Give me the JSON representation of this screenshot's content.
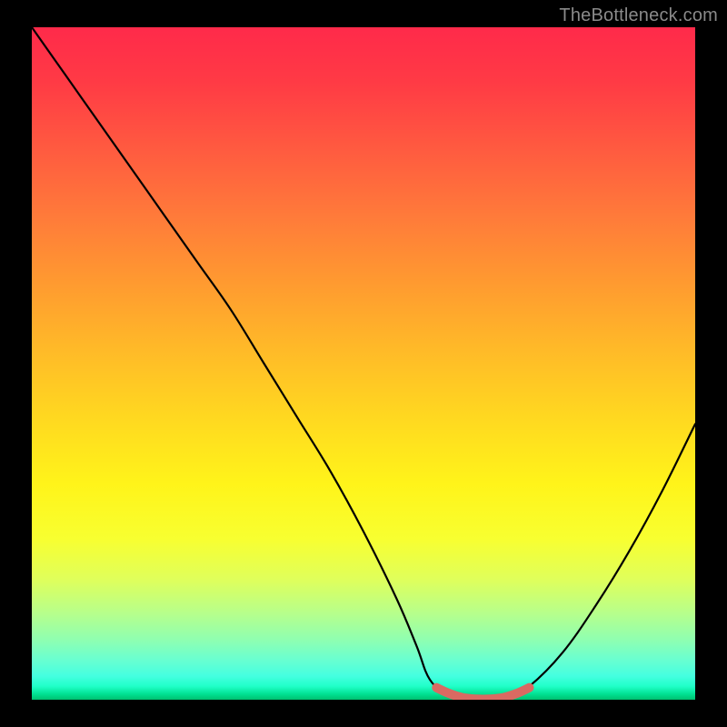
{
  "watermark": "TheBottleneck.com",
  "chart_data": {
    "type": "line",
    "title": "",
    "xlabel": "",
    "ylabel": "",
    "xlim": [
      0,
      100
    ],
    "ylim": [
      0,
      100
    ],
    "series": [
      {
        "name": "bottleneck-curve",
        "x": [
          0,
          5,
          10,
          15,
          20,
          25,
          30,
          35,
          40,
          45,
          50,
          55,
          58,
          60,
          63,
          66,
          69,
          72,
          75,
          80,
          85,
          90,
          95,
          100
        ],
        "values": [
          100,
          93,
          86,
          79,
          72,
          65,
          58,
          50,
          42,
          34,
          25,
          15,
          8,
          3,
          0.5,
          0,
          0,
          0.5,
          2,
          7,
          14,
          22,
          31,
          41
        ]
      },
      {
        "name": "optimal-range-marker",
        "x": [
          61,
          63,
          65,
          67,
          69,
          71,
          73,
          75
        ],
        "values": [
          1.8,
          0.9,
          0.3,
          0.1,
          0.1,
          0.3,
          0.9,
          1.8
        ]
      }
    ],
    "background_gradient": {
      "top_color": "#ff2a4a",
      "mid_color": "#fff41a",
      "bottom_color": "#00c070",
      "meaning": "red = high bottleneck, green = low bottleneck"
    },
    "optimal_range_x": [
      61,
      75
    ]
  }
}
